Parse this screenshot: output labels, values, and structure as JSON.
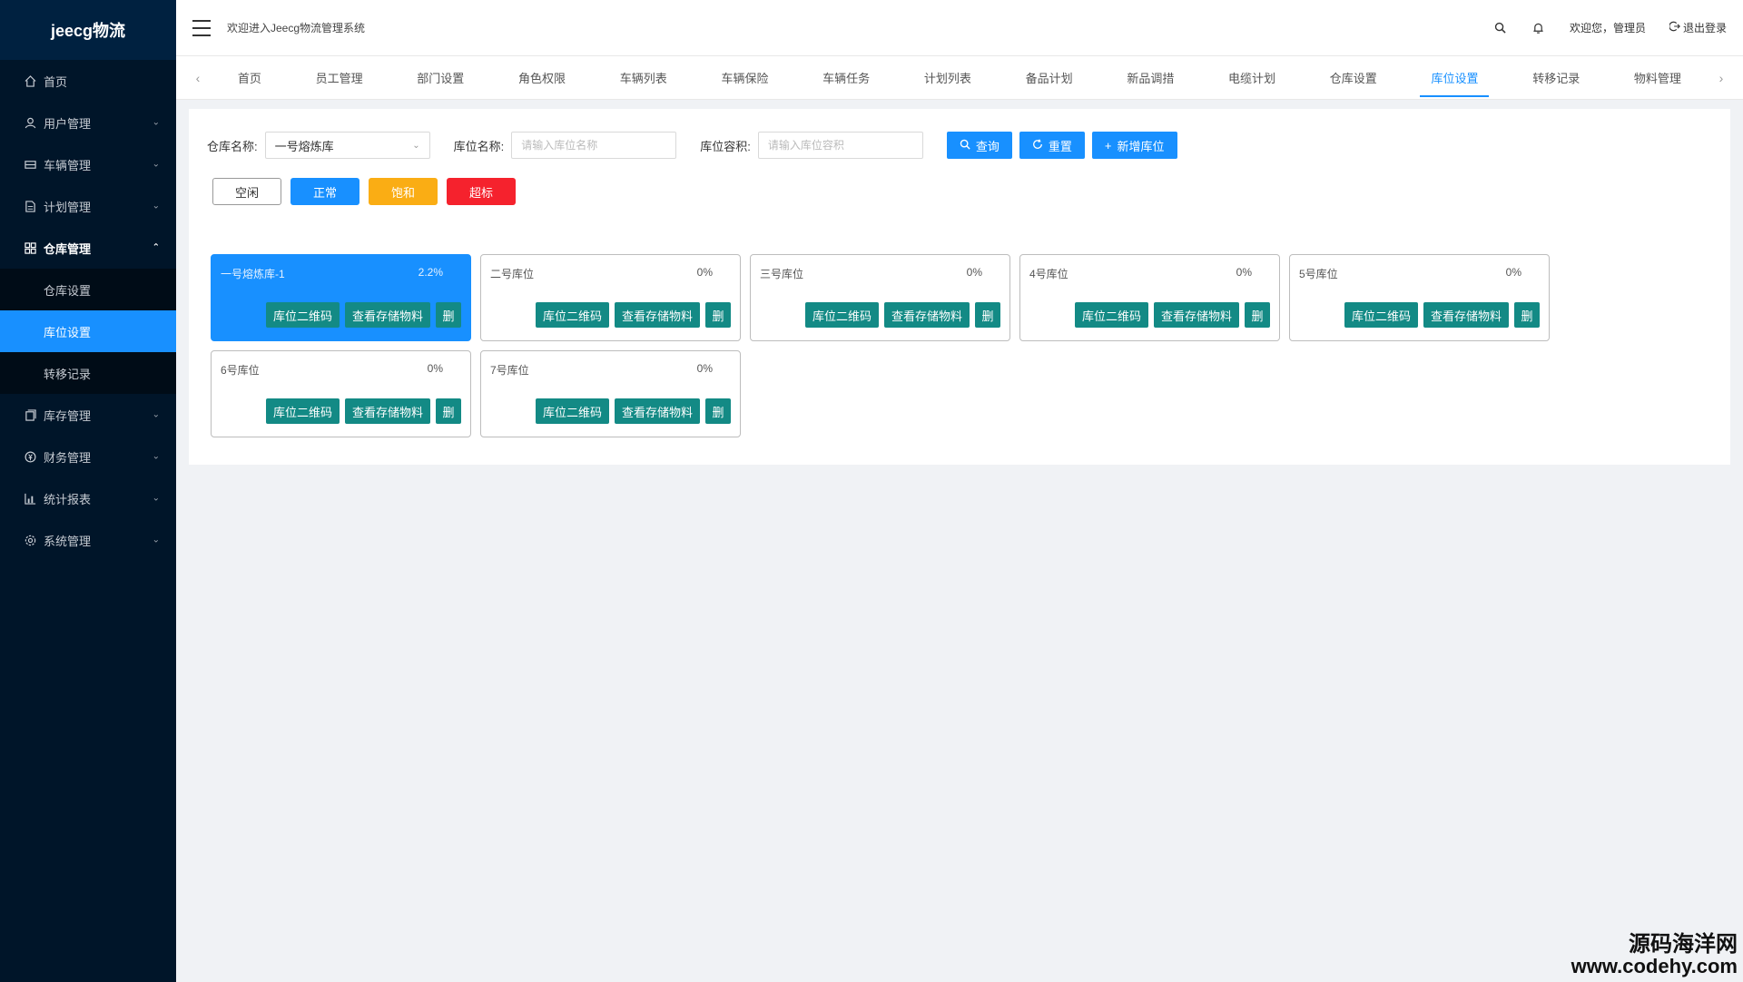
{
  "app": {
    "logo": "jeecg物流"
  },
  "header": {
    "welcome_system": "欢迎进入Jeecg物流管理系统",
    "greeting": "欢迎您，管理员",
    "logout": "退出登录"
  },
  "sidebar": {
    "items": [
      {
        "label": "首页",
        "icon": "home-icon"
      },
      {
        "label": "用户管理",
        "icon": "user-icon"
      },
      {
        "label": "车辆管理",
        "icon": "car-icon"
      },
      {
        "label": "计划管理",
        "icon": "document-icon"
      },
      {
        "label": "仓库管理",
        "icon": "grid-icon"
      },
      {
        "label": "库存管理",
        "icon": "copy-icon"
      },
      {
        "label": "财务管理",
        "icon": "money-icon"
      },
      {
        "label": "统计报表",
        "icon": "chart-icon"
      },
      {
        "label": "系统管理",
        "icon": "gear-icon"
      }
    ],
    "submenu": [
      {
        "label": "仓库设置"
      },
      {
        "label": "库位设置"
      },
      {
        "label": "转移记录"
      }
    ]
  },
  "tabs": [
    "首页",
    "员工管理",
    "部门设置",
    "角色权限",
    "车辆列表",
    "车辆保险",
    "车辆任务",
    "计划列表",
    "备品计划",
    "新品调措",
    "电缆计划",
    "仓库设置",
    "库位设置",
    "转移记录",
    "物料管理"
  ],
  "filters": {
    "warehouse_label": "仓库名称:",
    "warehouse_value": "一号熔炼库",
    "location_label": "库位名称:",
    "location_placeholder": "请输入库位名称",
    "capacity_label": "库位容积:",
    "capacity_placeholder": "请输入库位容积",
    "query_label": "查询",
    "reset_label": "重置",
    "add_label": "新增库位"
  },
  "legend": {
    "idle": "空闲",
    "normal": "正常",
    "full": "饱和",
    "over": "超标",
    "colors": {
      "normal": "#1890ff",
      "full": "#faad14",
      "over": "#f5222d"
    }
  },
  "card_actions": {
    "qr": "库位二维码",
    "view": "查看存储物料",
    "del": "删"
  },
  "locations": [
    {
      "name": "一号熔炼库-1",
      "percent": "2.2%",
      "active": true
    },
    {
      "name": "二号库位",
      "percent": "0%"
    },
    {
      "name": "三号库位",
      "percent": "0%"
    },
    {
      "name": "4号库位",
      "percent": "0%"
    },
    {
      "name": "5号库位",
      "percent": "0%"
    },
    {
      "name": "6号库位",
      "percent": "0%"
    },
    {
      "name": "7号库位",
      "percent": "0%"
    }
  ],
  "watermark": {
    "line1": "源码海洋网",
    "line2": "www.codehy.com"
  }
}
